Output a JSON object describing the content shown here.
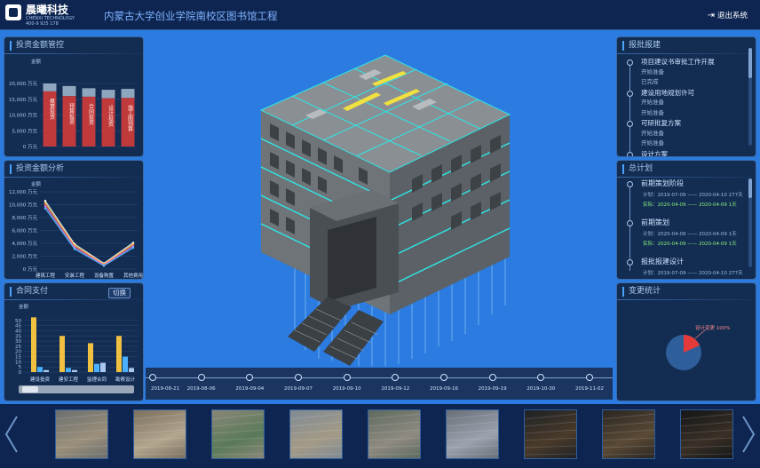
{
  "header": {
    "logo_name": "晨曦科技",
    "logo_sub": "CHENXI TECHNOLOGY",
    "logo_phone": "400-9 925 178",
    "project_title": "内蒙古大学创业学院南校区图书馆工程",
    "logout_label": "退出系统"
  },
  "panels": {
    "investment_management": {
      "title": "投资金额管控",
      "unit": "金额",
      "chart_data": {
        "type": "bar",
        "categories": [
          "概算投资",
          "预算投资",
          "合同投资",
          "设计投资",
          "施工图预算"
        ],
        "values": [
          17500,
          16000,
          15800,
          15300,
          15400
        ],
        "stack_tops": [
          20000,
          19200,
          18500,
          18000,
          18300
        ],
        "yticks": [
          "0 万元",
          "5,000 万元",
          "10,000 万元",
          "15,000 万元",
          "20,000 万元"
        ],
        "ylim": [
          0,
          20000
        ]
      }
    },
    "investment_analysis": {
      "title": "投资金额分析",
      "unit": "金额",
      "chart_data": {
        "type": "line",
        "categories": [
          "建筑工程",
          "安装工程",
          "设备购置",
          "其他费用"
        ],
        "series": [
          {
            "values": [
              10600,
              3900,
              900,
              4100
            ],
            "color": "#ffffff"
          },
          {
            "values": [
              10300,
              3700,
              800,
              3900
            ],
            "color": "#f0d04a"
          },
          {
            "values": [
              10000,
              3500,
              700,
              3700
            ],
            "color": "#ff6a6a"
          },
          {
            "values": [
              9700,
              3300,
              600,
              3500
            ],
            "color": "#b07cff"
          },
          {
            "values": [
              9400,
              3100,
              500,
              3300
            ],
            "color": "#4ac8ff"
          }
        ],
        "yticks": [
          "0 万元",
          "2,000 万元",
          "4,000 万元",
          "6,000 万元",
          "8,000 万元",
          "10,000 万元",
          "12,000 万元"
        ],
        "ylim": [
          0,
          12000
        ]
      }
    },
    "contract_payment": {
      "title": "合同支付",
      "switch_label": "切换",
      "unit": "金额",
      "chart_data": {
        "type": "bar",
        "categories": [
          "建设投资",
          "建安工程",
          "监理合同",
          "勘察设计"
        ],
        "series": [
          {
            "values": [
              53,
              35,
              28,
              35
            ],
            "color": "#f0c040"
          },
          {
            "values": [
              5,
              4,
              8,
              15
            ],
            "color": "#4ab0ff"
          },
          {
            "values": [
              2,
              2,
              9,
              4
            ],
            "color": "#a9c8ef"
          }
        ],
        "yticks": [
          "0",
          "5",
          "10",
          "15",
          "20",
          "25",
          "30",
          "35",
          "40",
          "45",
          "50"
        ],
        "ylim": [
          0,
          55
        ]
      }
    },
    "report_process": {
      "title": "报批报建",
      "items": [
        {
          "text": "项目建议书审批工作开展",
          "sub": false
        },
        {
          "text": "开始准备",
          "sub": true
        },
        {
          "text": "已完成",
          "sub": true
        },
        {
          "text": "建设用地规划许可",
          "sub": false
        },
        {
          "text": "开始准备",
          "sub": true
        },
        {
          "text": "开始准备",
          "sub": true
        },
        {
          "text": "可研批复方案",
          "sub": false
        },
        {
          "text": "开始准备",
          "sub": true
        },
        {
          "text": "开始准备",
          "sub": true
        },
        {
          "text": "设计方案",
          "sub": false
        }
      ]
    },
    "general_plan": {
      "title": "总计划",
      "items": [
        {
          "name": "前期策划阶段",
          "plan": "计划：2019-07-09 —— 2020-04-10   277天",
          "actual": "实际：2020-04-09 —— 2020-04-09   1天"
        },
        {
          "name": "前期策划",
          "plan": "计划：2020-04-09 —— 2020-04-09   1天",
          "actual": "实际：2020-04-09 —— 2020-04-09   1天"
        },
        {
          "name": "报批报建设计",
          "plan": "计划：2019-07-09 —— 2020-04-10   277天",
          "actual": ""
        }
      ]
    },
    "change_stats": {
      "title": "变更统计",
      "pie_label": "设计变更 100%",
      "chart_data": {
        "type": "pie",
        "slices": [
          {
            "name": "设计变更",
            "value": 100
          }
        ]
      }
    }
  },
  "timeline": {
    "dates": [
      "2019-08-21",
      "2019-08-06",
      "2019-09-04",
      "2019-09-07",
      "2019-09-10",
      "2019-09-12",
      "2019-09-16",
      "2019-09-19",
      "2019-10-30",
      "2019-11-02"
    ]
  },
  "photos": {
    "count": 9
  }
}
